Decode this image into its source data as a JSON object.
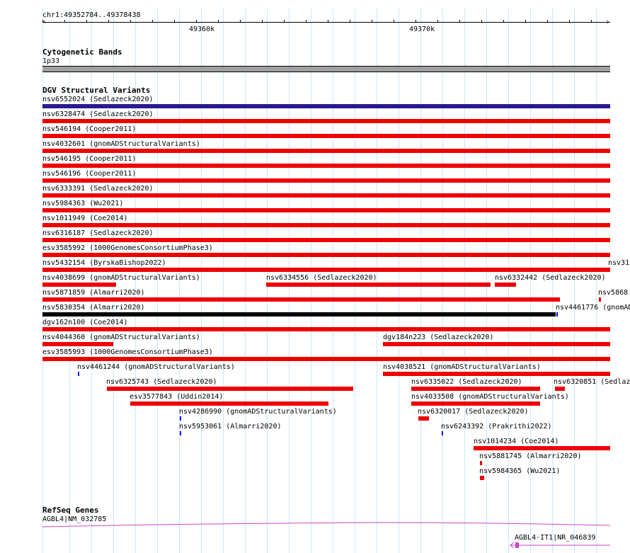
{
  "ruler": {
    "coords": "chr1:49352784..49378438",
    "tick_labels": [
      "49360k",
      "49370k"
    ],
    "start_arrow_glyph": "‹",
    "end_arrow_glyph": "›"
  },
  "cytoband": {
    "title": "Cytogenetic Bands",
    "band_label": "1p33",
    "band_color": "#a0a0a0"
  },
  "dgv": {
    "title": "DGV Structural Variants",
    "colors": {
      "loss": "#ee0000",
      "gain": "#2a1a8e",
      "complex": "#000000",
      "point": "#0000ee"
    },
    "features": [
      {
        "label": "nsv6552024 (Sedlazeck2020)",
        "type": "gain"
      },
      {
        "label": "nsv6328474 (Sedlazeck2020)",
        "type": "loss"
      },
      {
        "label": "nsv546194 (Cooper2011)",
        "type": "loss"
      },
      {
        "label": "nsv4032601 (gnomADStructuralVariants)",
        "type": "loss"
      },
      {
        "label": "nsv546195 (Cooper2011)",
        "type": "loss"
      },
      {
        "label": "nsv546196 (Cooper2011)",
        "type": "loss"
      },
      {
        "label": "nsv6333391 (Sedlazeck2020)",
        "type": "loss"
      },
      {
        "label": "nsv5984363 (Wu2021)",
        "type": "loss"
      },
      {
        "label": "nsv1011949 (Coe2014)",
        "type": "loss"
      },
      {
        "label": "nsv6316187 (Sedlazeck2020)",
        "type": "loss"
      },
      {
        "label": "esv3585992 (1000GenomesConsortiumPhase3)",
        "type": "loss"
      },
      {
        "label": "nsv5432154 (ByrskaBishop2022)",
        "type": "loss"
      },
      {
        "label": "nsv31",
        "type": "loss"
      },
      {
        "label": "nsv4038699 (gnomADStructuralVariants)",
        "type": "loss"
      },
      {
        "label": "nsv6334556 (Sedlazeck2020)",
        "type": "loss"
      },
      {
        "label": "nsv6332442 (Sedlazeck2020)",
        "type": "loss"
      },
      {
        "label": "nsv5871859 (Almarri2020)",
        "type": "loss"
      },
      {
        "label": "nsv5868",
        "type": "loss"
      },
      {
        "label": "nsv5830354 (Almarri2020)",
        "type": "complex"
      },
      {
        "label": "nsv4461776 (gnomAD",
        "type": "point"
      },
      {
        "label": "dgv162n100 (Coe2014)",
        "type": "loss"
      },
      {
        "label": "nsv4044360 (gnomADStructuralVariants)",
        "type": "loss"
      },
      {
        "label": "dgv184n223 (Sedlazeck2020)",
        "type": "loss"
      },
      {
        "label": "esv3585993 (1000GenomesConsortiumPhase3)",
        "type": "loss"
      },
      {
        "label": "nsv4461244 (gnomADStructuralVariants)",
        "type": "point"
      },
      {
        "label": "nsv4038521 (gnomADStructuralVariants)",
        "type": "loss"
      },
      {
        "label": "nsv6325743 (Sedlazeck2020)",
        "type": "loss"
      },
      {
        "label": "nsv6335022 (Sedlazeck2020)",
        "type": "loss"
      },
      {
        "label": "nsv6320851 (Sedlaz",
        "type": "loss"
      },
      {
        "label": "esv3577843 (Uddin2014)",
        "type": "loss"
      },
      {
        "label": "nsv4033508 (gnomADStructuralVariants)",
        "type": "loss"
      },
      {
        "label": "nsv4286990 (gnomADStructuralVariants)",
        "type": "point"
      },
      {
        "label": "nsv6320017 (Sedlazeck2020)",
        "type": "loss"
      },
      {
        "label": "nsv5953061 (Almarri2020)",
        "type": "point"
      },
      {
        "label": "nsv6243392 (Prakrithi2022)",
        "type": "point"
      },
      {
        "label": "nsv1014234 (Coe2014)",
        "type": "loss"
      },
      {
        "label": "nsv5881745 (Almarri2020)",
        "type": "loss"
      },
      {
        "label": "nsv5984365 (Wu2021)",
        "type": "loss"
      }
    ]
  },
  "refseq": {
    "title": "RefSeq Genes",
    "genes": [
      {
        "label": "AGBL4|NM_032785",
        "color": "#cc44cc"
      },
      {
        "label": "AGBL4-IT1|NR_046839",
        "color": "#cc44cc"
      }
    ]
  }
}
